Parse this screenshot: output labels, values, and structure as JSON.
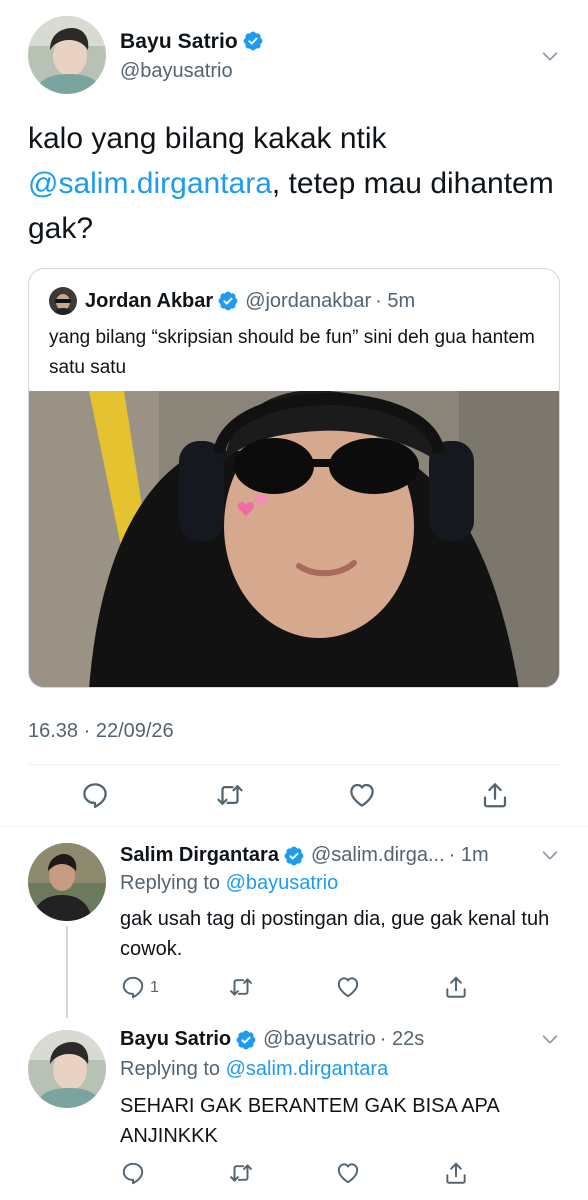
{
  "main_tweet": {
    "author_name": "Bayu Satrio",
    "author_handle": "@bayusatrio",
    "text_before": "kalo yang bilang kakak ntik ",
    "mention": "@salim.dirgantara",
    "text_after": ", tetep mau dihantem gak?",
    "timestamp": "16.38 · 22/09/26"
  },
  "quoted_tweet": {
    "author_name": "Jordan Akbar",
    "author_handle": "@jordanakbar",
    "time": "· 5m",
    "text": "yang bilang “skripsian should be fun” sini deh gua hantem satu satu"
  },
  "replies": [
    {
      "author_name": "Salim Dirgantara",
      "author_handle": "@salim.dirga...",
      "time": "· 1m",
      "replying_label": "Replying to",
      "replying_to": "@bayusatrio",
      "text": "gak usah tag di postingan dia, gue gak kenal tuh cowok.",
      "reply_count": "1"
    },
    {
      "author_name": "Bayu Satrio",
      "author_handle": "@bayusatrio",
      "time": "· 22s",
      "replying_label": "Replying to",
      "replying_to": "@salim.dirgantara",
      "text": "SEHARI GAK BERANTEM GAK BISA APA ANJINKKK",
      "reply_count": ""
    }
  ],
  "icons": {
    "verified": "verified-badge-icon",
    "more": "chevron-down-icon",
    "reply": "reply-icon",
    "retweet": "retweet-icon",
    "like": "like-icon",
    "share": "share-icon"
  },
  "colors": {
    "accent": "#1d9bf0",
    "secondary_text": "#536471",
    "border": "#cfd9de"
  }
}
